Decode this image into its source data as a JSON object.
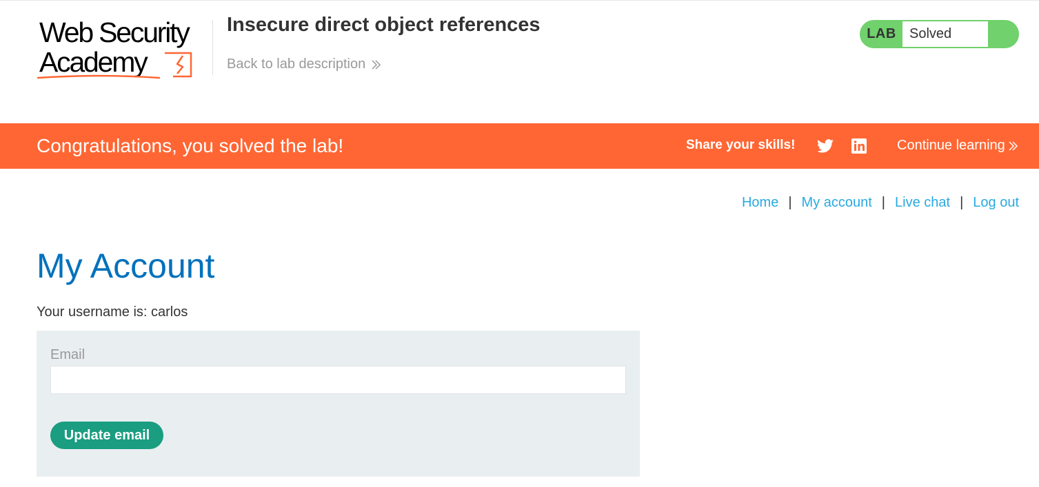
{
  "header": {
    "logo": {
      "line1": "Web Security",
      "line2": "Academy"
    },
    "lab_title": "Insecure direct object references",
    "back_link": "Back to lab description",
    "lab_status": {
      "tag": "LAB",
      "state": "Solved",
      "color": "#70d16d"
    }
  },
  "banner": {
    "message": "Congratulations, you solved the lab!",
    "share_label": "Share your skills!",
    "icons": [
      "twitter-icon",
      "linkedin-icon"
    ],
    "continue_label": "Continue learning",
    "color": "#ff6633"
  },
  "nav": {
    "items": [
      "Home",
      "My account",
      "Live chat",
      "Log out"
    ],
    "separator": "|"
  },
  "main": {
    "title": "My Account",
    "username_text": "Your username is: carlos",
    "form": {
      "email_label": "Email",
      "email_value": "",
      "submit_label": "Update email"
    }
  },
  "colors": {
    "link": "#29a9e1",
    "heading": "#0071bc",
    "button": "#1a9d80",
    "panel": "#e9eef1"
  }
}
